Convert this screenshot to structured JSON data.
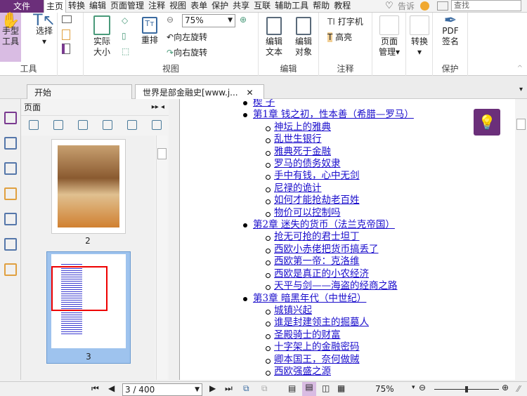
{
  "menu": {
    "file": "文件",
    "items": [
      "主页",
      "转换",
      "编辑",
      "页面管理",
      "注释",
      "视图",
      "表单",
      "保护",
      "共享",
      "互联",
      "辅助工具",
      "帮助",
      "教程"
    ],
    "tell": "告诉",
    "search_placeholder": "查找"
  },
  "ribbon": {
    "tools": {
      "hand": "手型\n工具",
      "select": "选择",
      "label": "工具"
    },
    "view": {
      "actual": "实际\n大小",
      "reflow": "重排",
      "zoom": "75%",
      "rotate_left": "向左旋转",
      "rotate_right": "向右旋转",
      "label": "视图"
    },
    "edit": {
      "edit_text": "编辑\n文本",
      "edit_object": "编辑\n对象",
      "label": "编辑"
    },
    "comment": {
      "typewriter": "打字机",
      "highlight": "高亮",
      "label": "注释"
    },
    "page": {
      "manage": "页面\n管理"
    },
    "convert": {
      "convert": "转换"
    },
    "protect": {
      "sign": "PDF\n签名",
      "label": "保护"
    }
  },
  "tabs": [
    {
      "label": "开始"
    },
    {
      "label": "世界是部金融史[www.j..."
    }
  ],
  "panel": {
    "title": "页面",
    "thumbs": [
      {
        "page": "2"
      },
      {
        "page": "3"
      }
    ]
  },
  "toc": [
    {
      "t": "楔 子",
      "lvl": 1
    },
    {
      "t": "第1章 钱之初，性本善（希腊—罗马）",
      "lvl": 1
    },
    {
      "t": "神坛上的雅典",
      "lvl": 2
    },
    {
      "t": "乱世生银行",
      "lvl": 2
    },
    {
      "t": "雅典死于金融",
      "lvl": 2
    },
    {
      "t": "罗马的债务奴隶",
      "lvl": 2
    },
    {
      "t": "手中有钱，心中无剑",
      "lvl": 2
    },
    {
      "t": "尼禄的诡计",
      "lvl": 2
    },
    {
      "t": "如何才能抢劫老百姓",
      "lvl": 2
    },
    {
      "t": "物价可以控制吗",
      "lvl": 2
    },
    {
      "t": "第2章 迷失的货币（法兰克帝国）",
      "lvl": 1
    },
    {
      "t": "抢无可抢的君士坦丁",
      "lvl": 2
    },
    {
      "t": "西欧小赤佬把货币搞丢了",
      "lvl": 2
    },
    {
      "t": "西欧第一帝：克洛维",
      "lvl": 2
    },
    {
      "t": "西欧是真正的小农经济",
      "lvl": 2
    },
    {
      "t": "天平与剑——海盗的经商之路",
      "lvl": 2
    },
    {
      "t": "第3章 暗黑年代（中世纪）",
      "lvl": 1
    },
    {
      "t": "城镇兴起",
      "lvl": 2
    },
    {
      "t": "谁是封建领主的掘墓人",
      "lvl": 2
    },
    {
      "t": "圣殿骑士的财富",
      "lvl": 2
    },
    {
      "t": "十字架上的金融密码",
      "lvl": 2
    },
    {
      "t": "卿本国王，奈何做贼",
      "lvl": 2
    },
    {
      "t": "西欧强盛之源",
      "lvl": 2
    }
  ],
  "status": {
    "page": "3 / 400",
    "zoom": "75%",
    "zoom_fraction": 0.5
  }
}
